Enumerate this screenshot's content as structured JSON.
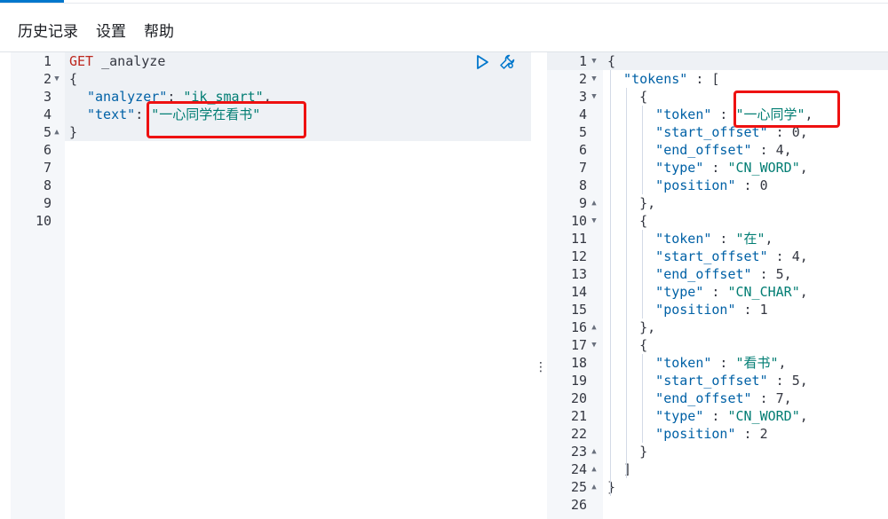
{
  "menu": {
    "history": "历史记录",
    "settings": "设置",
    "help": "帮助"
  },
  "request": {
    "line_numbers": [
      "1",
      "2",
      "3",
      "4",
      "5",
      "6",
      "7",
      "8",
      "9",
      "10"
    ],
    "method": "GET",
    "path": "_analyze",
    "l2": "{",
    "l3_key": "\"analyzer\"",
    "l3_colon": ": ",
    "l3_val": "\"ik_smart\"",
    "l3_comma": ",",
    "l4_key": "\"text\"",
    "l4_colon": ": ",
    "l4_val": "\"一心同学在看书\"",
    "l5": "}",
    "run_icon": "play-icon",
    "settings_icon": "wrench-icon"
  },
  "response": {
    "line_numbers": [
      "1",
      "2",
      "3",
      "4",
      "5",
      "6",
      "7",
      "8",
      "9",
      "10",
      "11",
      "12",
      "13",
      "14",
      "15",
      "16",
      "17",
      "18",
      "19",
      "20",
      "21",
      "22",
      "23",
      "24",
      "25",
      "26"
    ],
    "tokens": [
      {
        "token": "\"一心同学\"",
        "start_offset": "0",
        "end_offset": "4",
        "type": "\"CN_WORD\"",
        "position": "0"
      },
      {
        "token": "\"在\"",
        "start_offset": "4",
        "end_offset": "5",
        "type": "\"CN_CHAR\"",
        "position": "1"
      },
      {
        "token": "\"看书\"",
        "start_offset": "5",
        "end_offset": "7",
        "type": "\"CN_WORD\"",
        "position": "2"
      }
    ],
    "k_tokens": "\"tokens\"",
    "k_token": "\"token\"",
    "k_start": "\"start_offset\"",
    "k_end": "\"end_offset\"",
    "k_type": "\"type\"",
    "k_position": "\"position\""
  },
  "colors": {
    "method": "#bd271e",
    "key": "#0061a6",
    "string": "#017d73",
    "highlight_box": "#ee1111"
  }
}
